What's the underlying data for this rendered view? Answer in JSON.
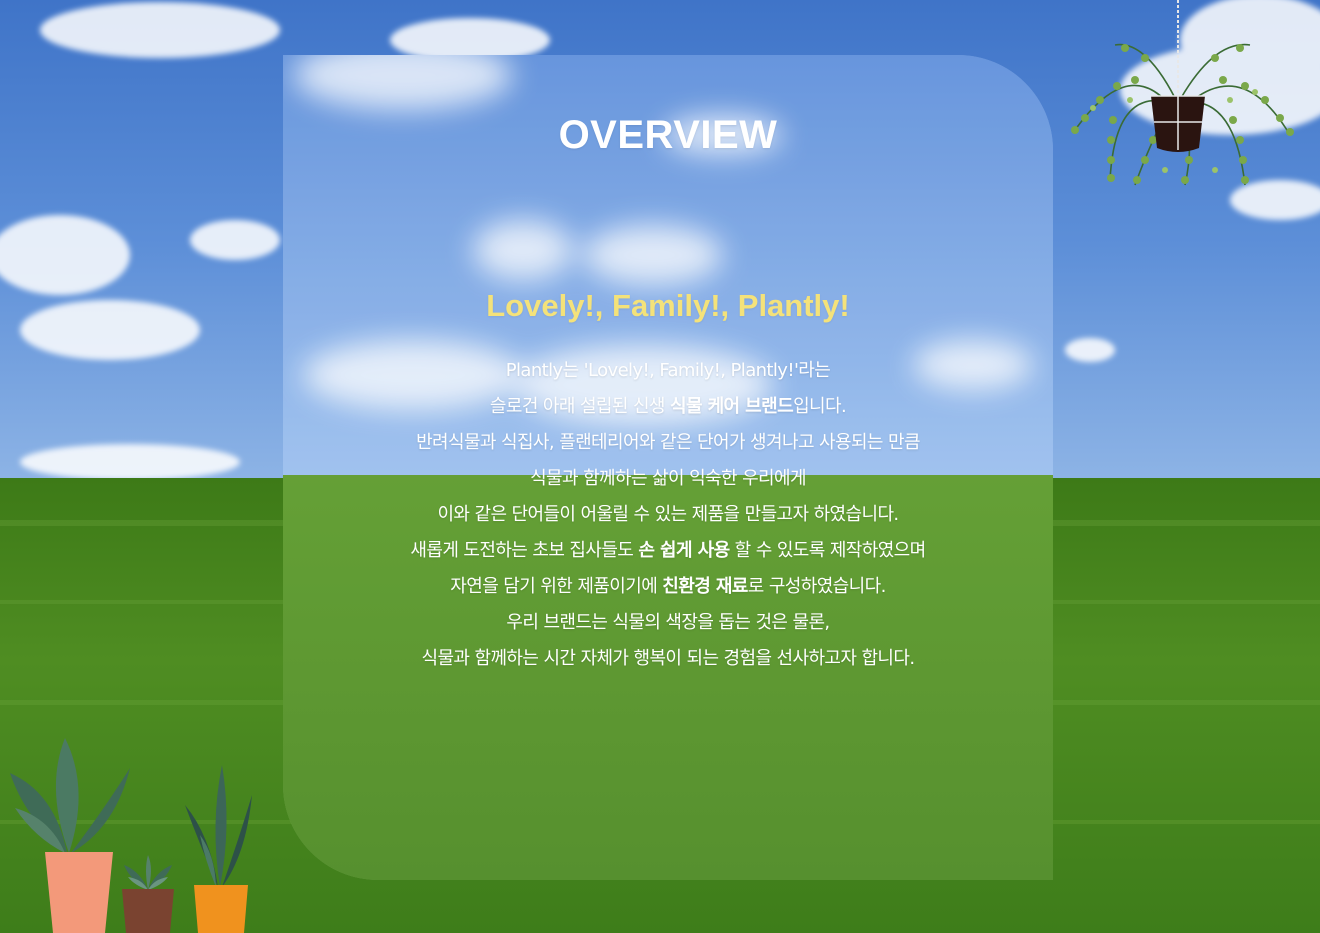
{
  "overview": {
    "title": "OVERVIEW",
    "slogan": "Lovely!, Family!, Plantly!",
    "lines": [
      {
        "text": "Plantly는 'Lovely!, Family!, Plantly!'라는"
      },
      {
        "before": "슬로건 아래 설립된 신생 ",
        "bold": "식물 케어 브랜드",
        "after": "입니다."
      },
      {
        "text": "반려식물과 식집사, 플랜테리어와 같은 단어가 생겨나고 사용되는 만큼"
      },
      {
        "text": "식물과 함께하는 삶이 익숙한 우리에게"
      },
      {
        "text": "이와 같은 단어들이 어울릴 수 있는 제품을 만들고자 하였습니다."
      },
      {
        "before": "새롭게 도전하는 초보 집사들도 ",
        "bold": "손 쉽게 사용",
        "after": " 할 수 있도록 제작하였으며"
      },
      {
        "before": "자연을 담기 위한 제품이기에 ",
        "bold": "친환경 재료",
        "after": "로 구성하였습니다."
      },
      {
        "text": "우리 브랜드는 식물의 색장을 돕는 것은 물론,"
      },
      {
        "text": "식물과 함께하는 시간 자체가 행복이 되는 경험을 선사하고자 합니다."
      }
    ]
  },
  "colors": {
    "sky": "#5b86d1",
    "grass": "#4f8a1f",
    "slogan": "#f4e27a"
  },
  "decorations": {
    "hanging_plant": "hanging-plant-icon",
    "potted_plants": [
      "potted-plant-icon",
      "succulent-icon",
      "snake-plant-icon"
    ]
  }
}
